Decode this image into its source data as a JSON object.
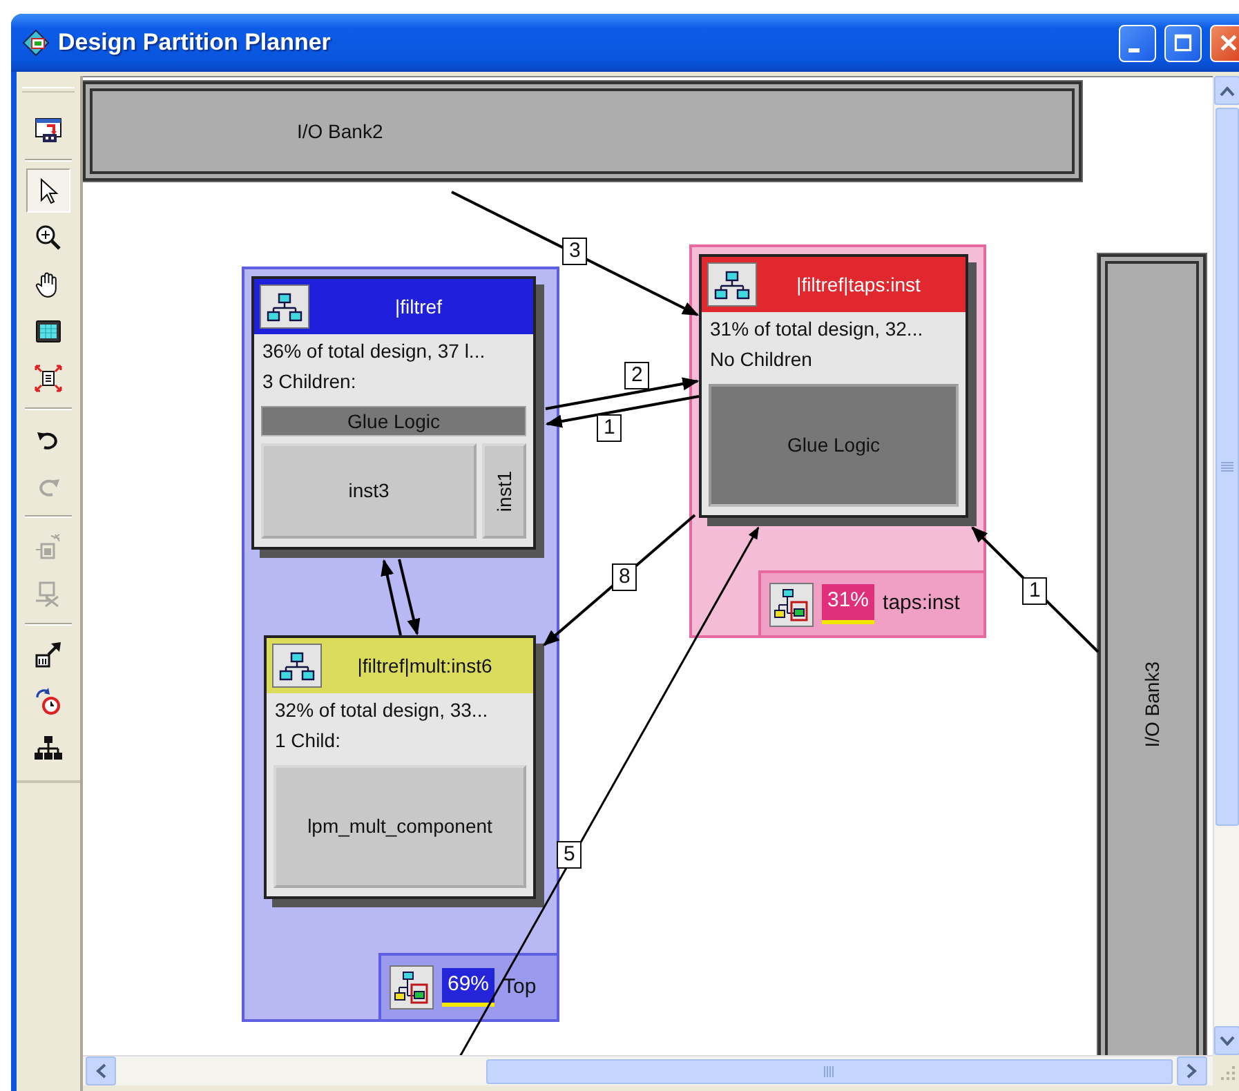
{
  "window": {
    "title": "Design Partition Planner"
  },
  "toolbar": [
    [
      {
        "kind": "planner",
        "selected": false,
        "disabled": false
      }
    ],
    [
      {
        "kind": "pointer",
        "selected": true,
        "disabled": false
      },
      {
        "kind": "zoom",
        "selected": false,
        "disabled": false
      },
      {
        "kind": "pan",
        "selected": false,
        "disabled": false
      },
      {
        "kind": "fit",
        "selected": false,
        "disabled": false
      },
      {
        "kind": "expand",
        "selected": false,
        "disabled": false
      }
    ],
    [
      {
        "kind": "undo",
        "selected": false,
        "disabled": false
      },
      {
        "kind": "redo",
        "selected": false,
        "disabled": true
      }
    ],
    [
      {
        "kind": "create",
        "selected": false,
        "disabled": true
      },
      {
        "kind": "remove",
        "selected": false,
        "disabled": true
      }
    ],
    [
      {
        "kind": "connect",
        "selected": false,
        "disabled": false
      },
      {
        "kind": "refresh",
        "selected": false,
        "disabled": false
      },
      {
        "kind": "hierarchy",
        "selected": false,
        "disabled": false
      }
    ]
  ],
  "io_banks": [
    {
      "label": "I/O Bank2",
      "kind": "horizontal"
    },
    {
      "label": "I/O Bank3",
      "kind": "vertical"
    }
  ],
  "regions": [
    {
      "color": "#b8b8f4",
      "badge": {
        "text": "69%",
        "color": "#2424d8"
      },
      "name": "Top"
    },
    {
      "color": "#f4bcd6",
      "badge": {
        "text": "31%",
        "color": "#e0307c"
      },
      "name": "taps:inst"
    }
  ],
  "nodes": [
    {
      "title": "|filtref",
      "color": "#2020dc",
      "summary": "36% of total design, 37 l...",
      "children_label": "3 Children:",
      "children": [
        {
          "label": "Glue Logic",
          "kind": "glue"
        },
        {
          "label": "inst3",
          "kind": "block"
        },
        {
          "label": "inst1",
          "kind": "vertical"
        }
      ]
    },
    {
      "title": "|filtref|taps:inst",
      "color": "#e0282e",
      "summary": "31% of total design, 32...",
      "children_label": "No Children",
      "children": [
        {
          "label": "Glue Logic",
          "kind": "glue"
        }
      ]
    },
    {
      "title": "|filtref|mult:inst6",
      "color": "#dcdc5c",
      "summary": "32% of total design, 33...",
      "children_label": "1 Child:",
      "children": [
        {
          "label": "lpm_mult_component",
          "kind": "block"
        }
      ]
    }
  ],
  "connections": [
    {
      "label": "3"
    },
    {
      "label": "2"
    },
    {
      "label": "1"
    },
    {
      "label": "8"
    },
    {
      "label": "1"
    },
    {
      "label": "5"
    }
  ]
}
